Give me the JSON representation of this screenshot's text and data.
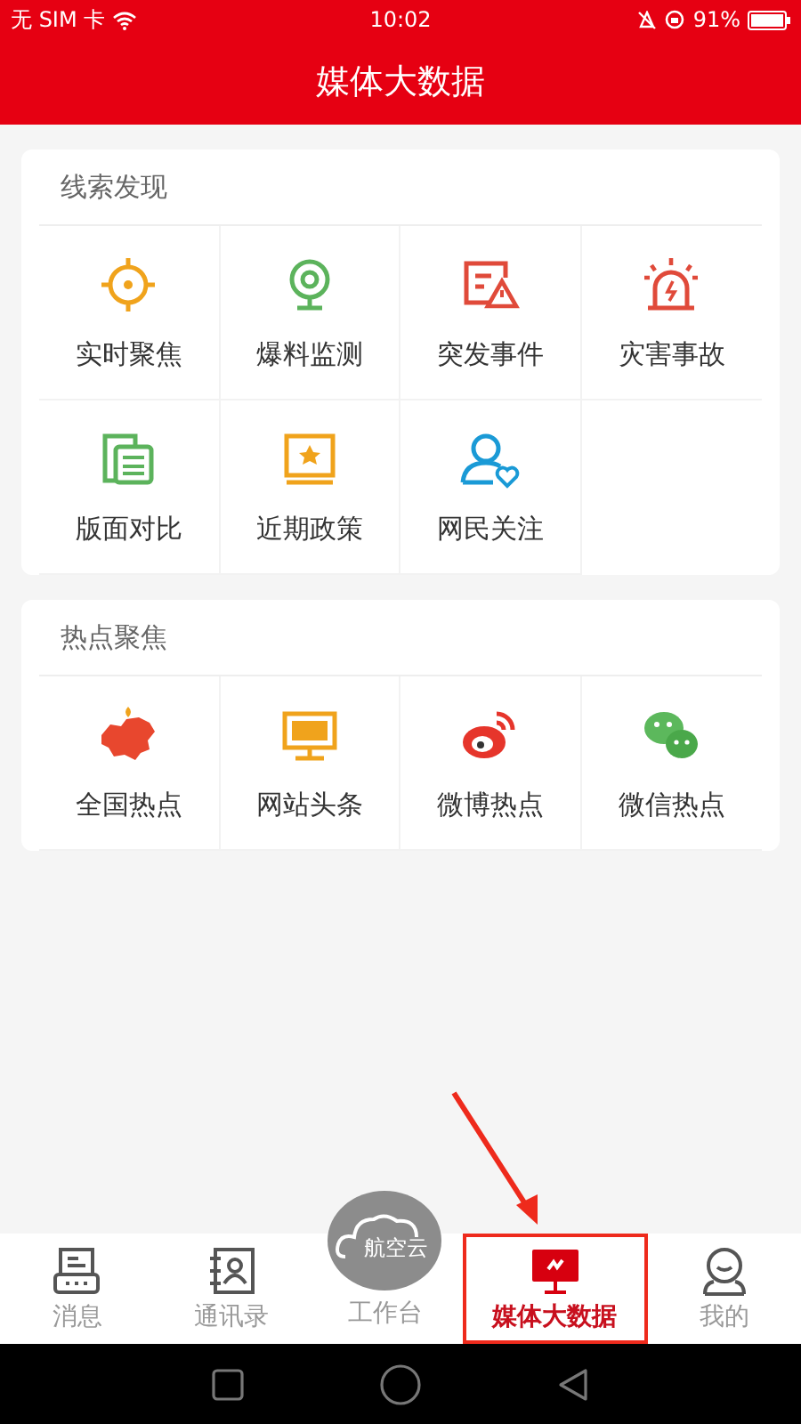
{
  "status_bar": {
    "carrier": "无 SIM 卡",
    "time": "10:02",
    "battery": "91%"
  },
  "header": {
    "title": "媒体大数据"
  },
  "sections": [
    {
      "title": "线索发现",
      "items": [
        {
          "label": "实时聚焦"
        },
        {
          "label": "爆料监测"
        },
        {
          "label": "突发事件"
        },
        {
          "label": "灾害事故"
        },
        {
          "label": "版面对比"
        },
        {
          "label": "近期政策"
        },
        {
          "label": "网民关注"
        }
      ]
    },
    {
      "title": "热点聚焦",
      "items": [
        {
          "label": "全国热点"
        },
        {
          "label": "网站头条"
        },
        {
          "label": "微博热点"
        },
        {
          "label": "微信热点"
        }
      ]
    }
  ],
  "tab_bar": [
    {
      "label": "消息",
      "kind": "normal",
      "selected": false,
      "highlighted": false
    },
    {
      "label": "通讯录",
      "kind": "normal",
      "selected": false,
      "highlighted": false
    },
    {
      "label": "工作台",
      "kind": "center",
      "logo_text": "航空云",
      "selected": false,
      "highlighted": false
    },
    {
      "label": "媒体大数据",
      "kind": "normal",
      "selected": true,
      "highlighted": true
    },
    {
      "label": "我的",
      "kind": "normal",
      "selected": false,
      "highlighted": false
    }
  ]
}
